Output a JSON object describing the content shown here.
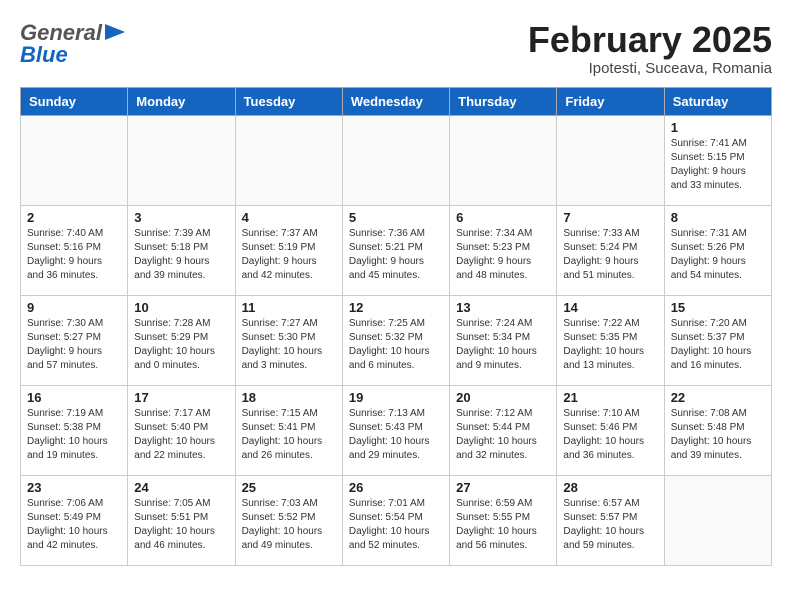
{
  "header": {
    "logo_line1": "General",
    "logo_line2": "Blue",
    "month_title": "February 2025",
    "location": "Ipotesti, Suceava, Romania"
  },
  "weekdays": [
    "Sunday",
    "Monday",
    "Tuesday",
    "Wednesday",
    "Thursday",
    "Friday",
    "Saturday"
  ],
  "weeks": [
    [
      {
        "day": "",
        "info": ""
      },
      {
        "day": "",
        "info": ""
      },
      {
        "day": "",
        "info": ""
      },
      {
        "day": "",
        "info": ""
      },
      {
        "day": "",
        "info": ""
      },
      {
        "day": "",
        "info": ""
      },
      {
        "day": "1",
        "info": "Sunrise: 7:41 AM\nSunset: 5:15 PM\nDaylight: 9 hours and 33 minutes."
      }
    ],
    [
      {
        "day": "2",
        "info": "Sunrise: 7:40 AM\nSunset: 5:16 PM\nDaylight: 9 hours and 36 minutes."
      },
      {
        "day": "3",
        "info": "Sunrise: 7:39 AM\nSunset: 5:18 PM\nDaylight: 9 hours and 39 minutes."
      },
      {
        "day": "4",
        "info": "Sunrise: 7:37 AM\nSunset: 5:19 PM\nDaylight: 9 hours and 42 minutes."
      },
      {
        "day": "5",
        "info": "Sunrise: 7:36 AM\nSunset: 5:21 PM\nDaylight: 9 hours and 45 minutes."
      },
      {
        "day": "6",
        "info": "Sunrise: 7:34 AM\nSunset: 5:23 PM\nDaylight: 9 hours and 48 minutes."
      },
      {
        "day": "7",
        "info": "Sunrise: 7:33 AM\nSunset: 5:24 PM\nDaylight: 9 hours and 51 minutes."
      },
      {
        "day": "8",
        "info": "Sunrise: 7:31 AM\nSunset: 5:26 PM\nDaylight: 9 hours and 54 minutes."
      }
    ],
    [
      {
        "day": "9",
        "info": "Sunrise: 7:30 AM\nSunset: 5:27 PM\nDaylight: 9 hours and 57 minutes."
      },
      {
        "day": "10",
        "info": "Sunrise: 7:28 AM\nSunset: 5:29 PM\nDaylight: 10 hours and 0 minutes."
      },
      {
        "day": "11",
        "info": "Sunrise: 7:27 AM\nSunset: 5:30 PM\nDaylight: 10 hours and 3 minutes."
      },
      {
        "day": "12",
        "info": "Sunrise: 7:25 AM\nSunset: 5:32 PM\nDaylight: 10 hours and 6 minutes."
      },
      {
        "day": "13",
        "info": "Sunrise: 7:24 AM\nSunset: 5:34 PM\nDaylight: 10 hours and 9 minutes."
      },
      {
        "day": "14",
        "info": "Sunrise: 7:22 AM\nSunset: 5:35 PM\nDaylight: 10 hours and 13 minutes."
      },
      {
        "day": "15",
        "info": "Sunrise: 7:20 AM\nSunset: 5:37 PM\nDaylight: 10 hours and 16 minutes."
      }
    ],
    [
      {
        "day": "16",
        "info": "Sunrise: 7:19 AM\nSunset: 5:38 PM\nDaylight: 10 hours and 19 minutes."
      },
      {
        "day": "17",
        "info": "Sunrise: 7:17 AM\nSunset: 5:40 PM\nDaylight: 10 hours and 22 minutes."
      },
      {
        "day": "18",
        "info": "Sunrise: 7:15 AM\nSunset: 5:41 PM\nDaylight: 10 hours and 26 minutes."
      },
      {
        "day": "19",
        "info": "Sunrise: 7:13 AM\nSunset: 5:43 PM\nDaylight: 10 hours and 29 minutes."
      },
      {
        "day": "20",
        "info": "Sunrise: 7:12 AM\nSunset: 5:44 PM\nDaylight: 10 hours and 32 minutes."
      },
      {
        "day": "21",
        "info": "Sunrise: 7:10 AM\nSunset: 5:46 PM\nDaylight: 10 hours and 36 minutes."
      },
      {
        "day": "22",
        "info": "Sunrise: 7:08 AM\nSunset: 5:48 PM\nDaylight: 10 hours and 39 minutes."
      }
    ],
    [
      {
        "day": "23",
        "info": "Sunrise: 7:06 AM\nSunset: 5:49 PM\nDaylight: 10 hours and 42 minutes."
      },
      {
        "day": "24",
        "info": "Sunrise: 7:05 AM\nSunset: 5:51 PM\nDaylight: 10 hours and 46 minutes."
      },
      {
        "day": "25",
        "info": "Sunrise: 7:03 AM\nSunset: 5:52 PM\nDaylight: 10 hours and 49 minutes."
      },
      {
        "day": "26",
        "info": "Sunrise: 7:01 AM\nSunset: 5:54 PM\nDaylight: 10 hours and 52 minutes."
      },
      {
        "day": "27",
        "info": "Sunrise: 6:59 AM\nSunset: 5:55 PM\nDaylight: 10 hours and 56 minutes."
      },
      {
        "day": "28",
        "info": "Sunrise: 6:57 AM\nSunset: 5:57 PM\nDaylight: 10 hours and 59 minutes."
      },
      {
        "day": "",
        "info": ""
      }
    ]
  ]
}
